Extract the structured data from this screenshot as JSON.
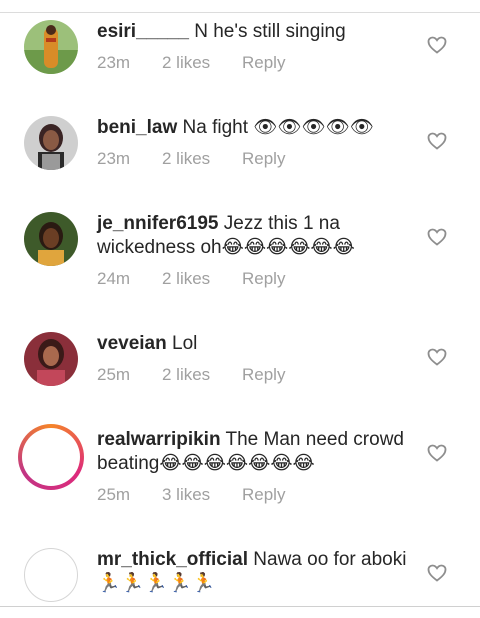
{
  "comments": [
    {
      "username": "esiri_____",
      "text": "N he's still singing",
      "time": "23m",
      "likes": "2 likes",
      "reply": "Reply",
      "avatar": "photo",
      "colors": [
        "#d9a441",
        "#8fb06a"
      ]
    },
    {
      "username": "beni_law",
      "text": "Na fight 👁👁👁👁👁",
      "time": "23m",
      "likes": "2 likes",
      "reply": "Reply",
      "avatar": "photo",
      "colors": [
        "#3a2a2a",
        "#c7c7c7"
      ]
    },
    {
      "username": "je_nnifer6195",
      "text": "Jezz this 1 na wickedness oh😂😂😂😂😂😂",
      "time": "24m",
      "likes": "2 likes",
      "reply": "Reply",
      "avatar": "photo",
      "colors": [
        "#2c3e1f",
        "#e0a53d"
      ]
    },
    {
      "username": "veveian",
      "text": "Lol",
      "time": "25m",
      "likes": "2 likes",
      "reply": "Reply",
      "avatar": "photo",
      "colors": [
        "#7a2c33",
        "#e2a0a0"
      ]
    },
    {
      "username": "realwarripikin",
      "text": "The Man need crowd beating😂😂😂😂😂😂😂",
      "time": "25m",
      "likes": "3 likes",
      "reply": "Reply",
      "avatar": "ring"
    },
    {
      "username": "mr_thick_official",
      "text": "Nawa oo for aboki 🏃🏃🏃🏃🏃",
      "time": "",
      "likes": "",
      "reply": "",
      "avatar": "empty"
    }
  ],
  "colors": {
    "meta_text": "#a0a0a0",
    "text": "#262626",
    "heart_outline": "#8e8e8e"
  }
}
